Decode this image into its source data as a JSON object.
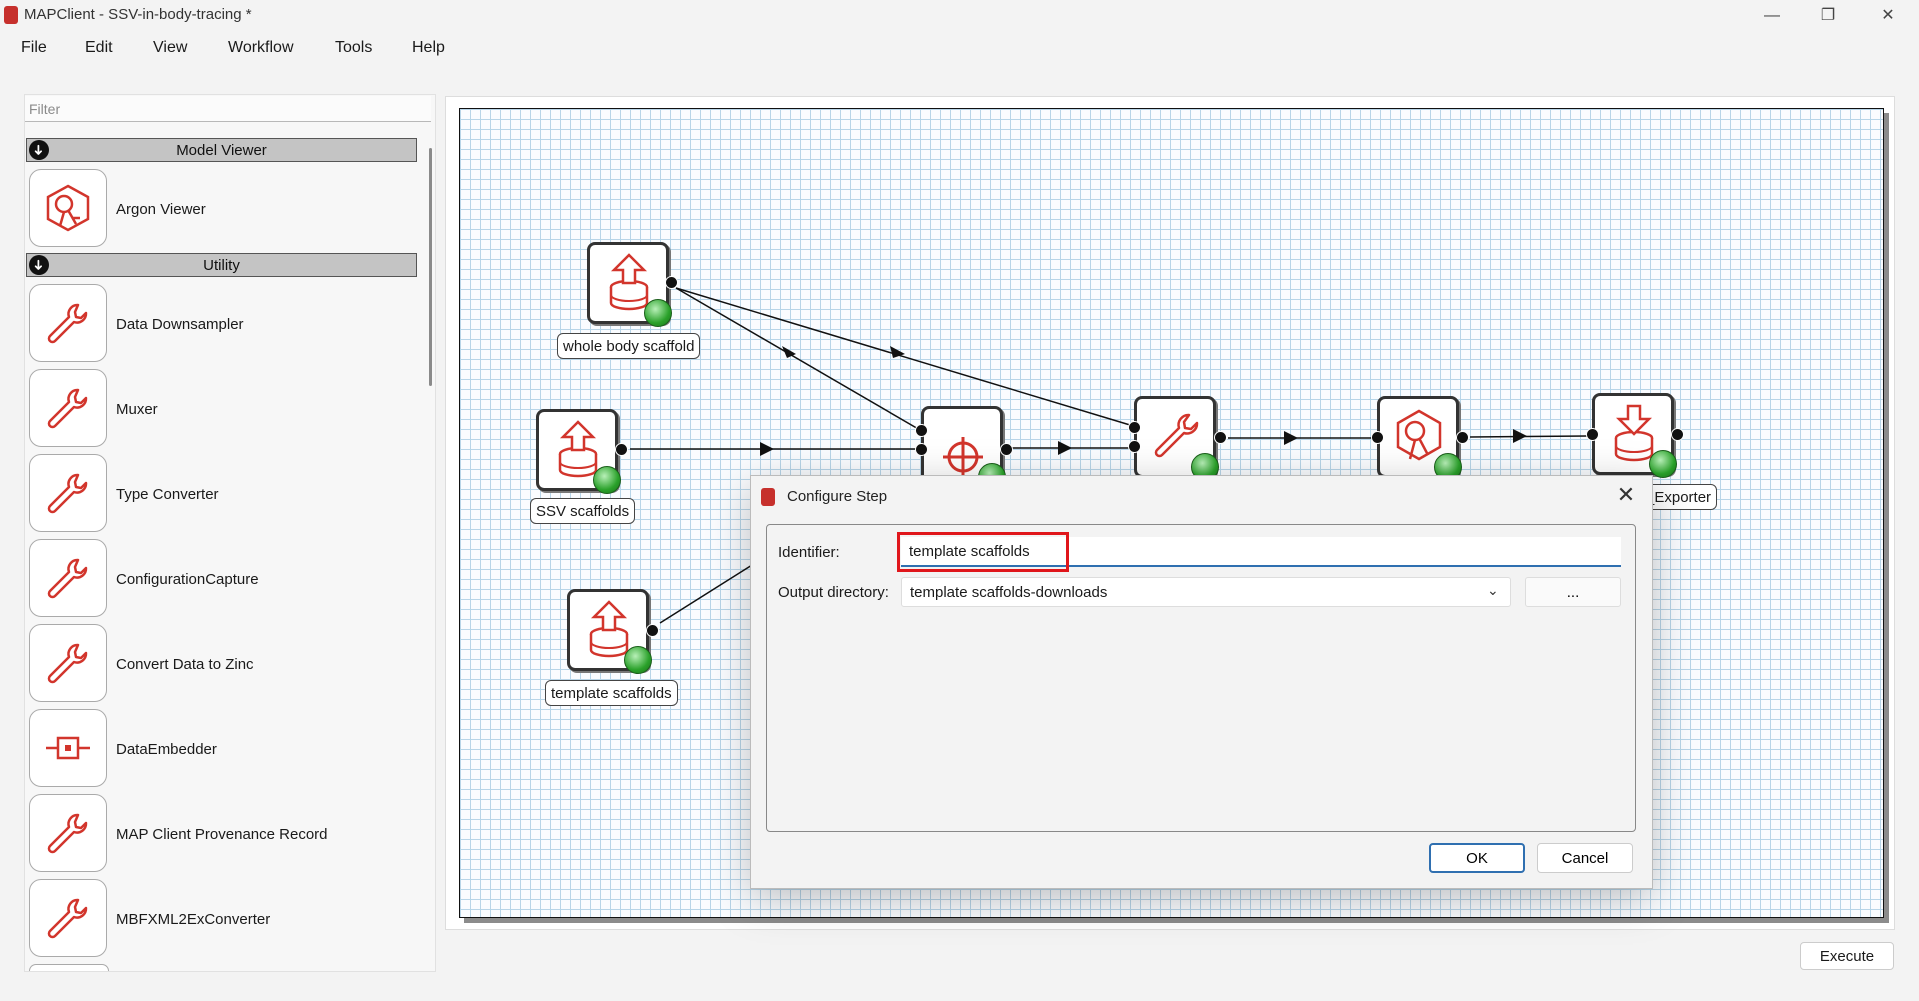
{
  "window": {
    "title": "MAPClient - SSV-in-body-tracing *",
    "minimize_glyph": "—",
    "maximize_glyph": "❐",
    "close_glyph": "✕"
  },
  "menu": [
    "File",
    "Edit",
    "View",
    "Workflow",
    "Tools",
    "Help"
  ],
  "sidebar": {
    "filter_placeholder": "Filter",
    "categories": [
      {
        "label": "Model Viewer",
        "expand_glyph": "➜"
      },
      {
        "label": "Utility",
        "expand_glyph": "➜"
      }
    ],
    "plugins": [
      {
        "label": "Argon Viewer",
        "icon": "argon-viewer-icon"
      },
      {
        "label": "Data Downsampler",
        "icon": "wrench-icon"
      },
      {
        "label": "Muxer",
        "icon": "wrench-icon"
      },
      {
        "label": "Type Converter",
        "icon": "wrench-icon"
      },
      {
        "label": "ConfigurationCapture",
        "icon": "wrench-icon"
      },
      {
        "label": "Convert Data to Zinc",
        "icon": "wrench-icon"
      },
      {
        "label": "DataEmbedder",
        "icon": "data-embedder-icon"
      },
      {
        "label": "MAP Client Provenance Record",
        "icon": "wrench-icon"
      },
      {
        "label": "MBFXML2ExConverter",
        "icon": "wrench-icon"
      }
    ]
  },
  "workflow": {
    "steps": [
      {
        "id": "whole-body-scaffold",
        "label": "whole body scaffold",
        "icon": "upload-database-icon"
      },
      {
        "id": "ssv-scaffolds",
        "label": "SSV scaffolds",
        "icon": "upload-database-icon"
      },
      {
        "id": "template-scaffolds",
        "label": "template scaffolds",
        "icon": "upload-database-icon"
      },
      {
        "id": "tracker-step",
        "label": "",
        "icon": "crosshair-icon"
      },
      {
        "id": "utility-step",
        "label": "",
        "icon": "wrench-icon"
      },
      {
        "id": "viewer-step",
        "label": "",
        "icon": "argon-viewer-icon"
      },
      {
        "id": "exporter-step",
        "label": "_Exporter",
        "icon": "download-database-icon"
      }
    ]
  },
  "execute_label": "Execute",
  "dialog": {
    "title": "Configure Step",
    "close_glyph": "✕",
    "identifier_label": "Identifier:",
    "identifier_value": "template scaffolds",
    "output_dir_label": "Output directory:",
    "output_dir_value": "template scaffolds-downloads",
    "browse_label": "...",
    "ok_label": "OK",
    "cancel_label": "Cancel"
  },
  "colors": {
    "accent": "#2f6fb0",
    "highlight": "#e0161b",
    "icon_red": "#d2352c",
    "grid": "#b8d5e8"
  }
}
